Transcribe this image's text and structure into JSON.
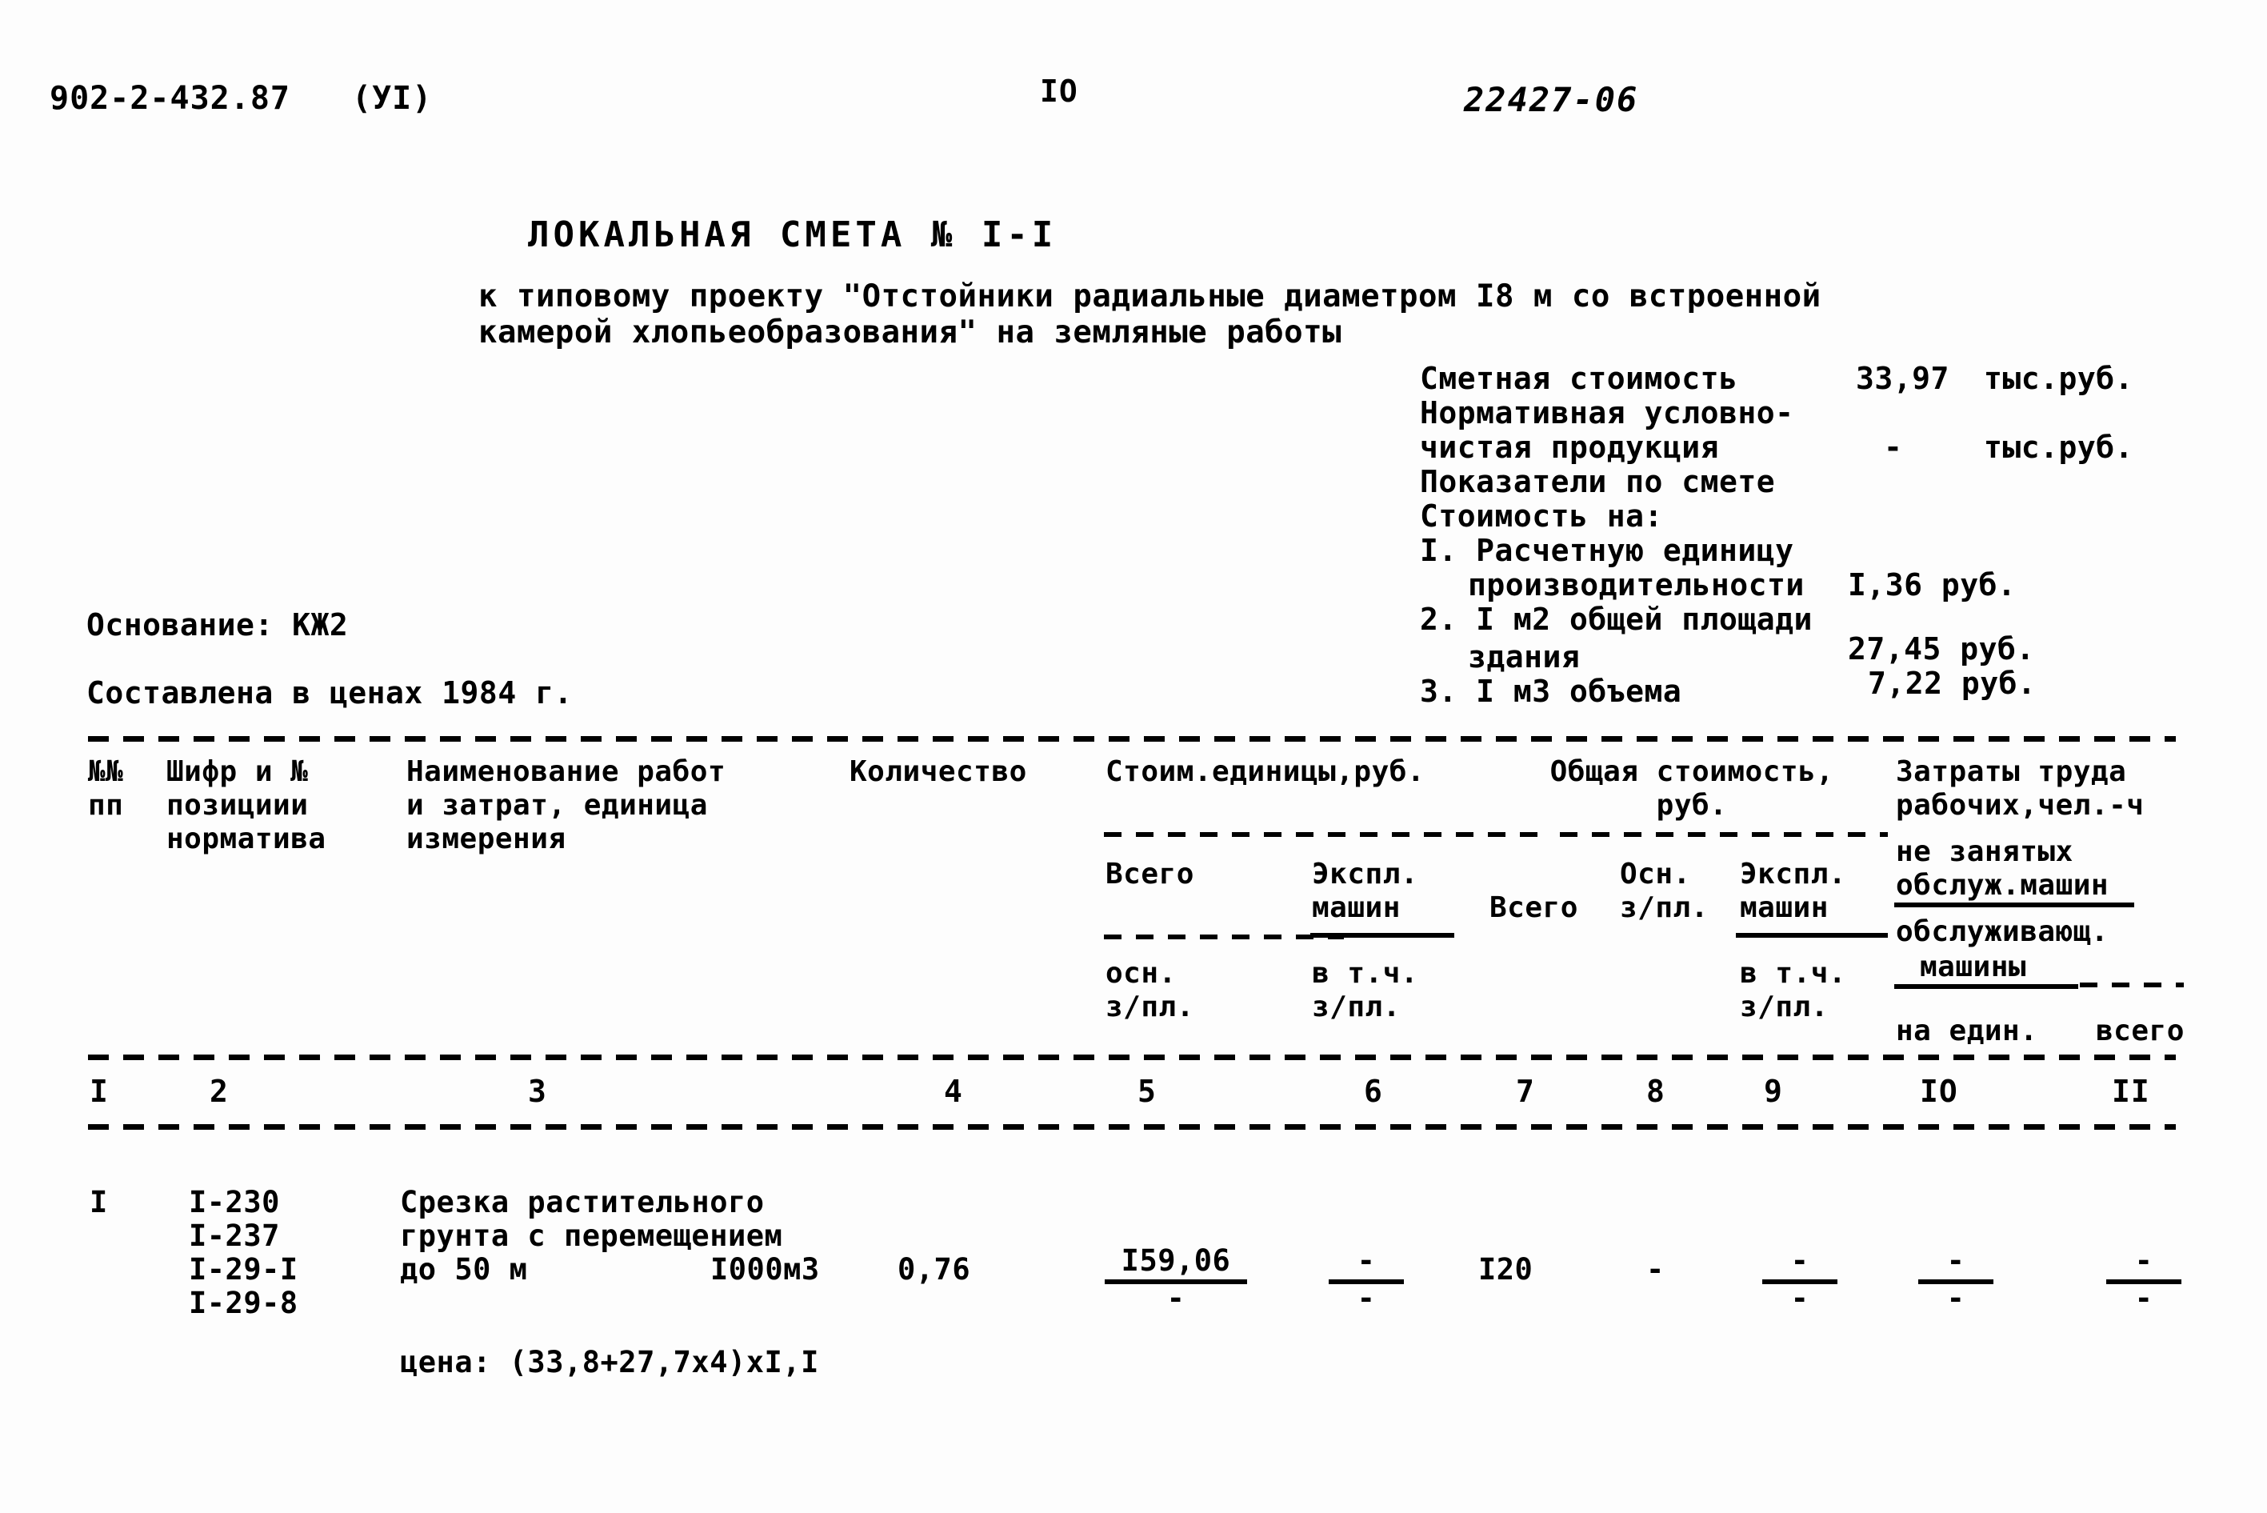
{
  "header": {
    "doc_code": "902-2-432.87",
    "section_roman": "(УI)",
    "page_number": "IO",
    "archive_stamp": "22427-06"
  },
  "title": {
    "main": "ЛОКАЛЬНАЯ СМЕТА № I-I",
    "subtitle_line1": "к типовому проекту \"Отстойники радиальные диаметром I8 м со встроенной",
    "subtitle_line2": "камерой хлопьеобразования\" на земляные работы"
  },
  "summary": {
    "rows": [
      {
        "label": "Сметная стоимость",
        "value": "33,97",
        "unit": "тыс.руб."
      },
      {
        "label": "Нормативная условно-",
        "value": "",
        "unit": ""
      },
      {
        "label": "чистая продукция",
        "value": "-",
        "unit": "тыс.руб."
      },
      {
        "label": "Показатели по смете",
        "value": "",
        "unit": ""
      },
      {
        "label": "Стоимость на:",
        "value": "",
        "unit": ""
      },
      {
        "label": "I. Расчетную единицу",
        "value": "",
        "unit": ""
      },
      {
        "label": "производительности",
        "value": "I,36 руб.",
        "unit": ""
      },
      {
        "label": "2. I м2 общей площади",
        "value": "",
        "unit": ""
      },
      {
        "label": "здания",
        "value": "27,45 руб.",
        "unit": ""
      },
      {
        "label": "3. I м3 объема",
        "value": "7,22 руб.",
        "unit": ""
      }
    ]
  },
  "meta": {
    "basis_label": "Основание: КЖ2",
    "prices_label": "Составлена в ценах 1984 г."
  },
  "table": {
    "headers": {
      "col1": "№№\nпп",
      "col2": "Шифр и №\nпозициии\nнорматива",
      "col3": "Наименование работ\nи затрат, единица\nизмерения",
      "col4": "Количество",
      "col5_group": "Стоим.единицы,руб.",
      "col8_group": "Общая стоимость,\nруб.",
      "col10_group": "Затраты труда\nрабочих,чел.-ч",
      "sub_vsego": "Всего",
      "sub_ekspl_mashin": "Экспл.\nмашин",
      "sub_osn_zpl": "осн.\nз/пл.",
      "sub_vtch_zpl": "в т.ч.\nз/пл.",
      "sub_vsego2": "Всего",
      "sub_osn_zpl2": "Осн.\nз/пл.",
      "sub_ekspl_mashin2": "Экспл.\nмашин",
      "sub_vtch_zpl2": "в т.ч.\nз/пл.",
      "sub_ne_zanyatyh": "не занятых",
      "sub_obsluzh_mashin": "обслуж.машин",
      "sub_obsluzhivayushch": "обслуживающ.",
      "sub_mashiny": "машины",
      "sub_na_edin": "на един.",
      "sub_vsego3": "всего"
    },
    "column_numbers": [
      "I",
      "2",
      "3",
      "4",
      "5",
      "6",
      "7",
      "8",
      "9",
      "IO",
      "II"
    ],
    "rows": [
      {
        "no": "I",
        "code_lines": [
          "I-230",
          "I-237",
          "I-29-I",
          "I-29-8"
        ],
        "name_lines": [
          "Срезка растительного",
          "грунта с перемещением",
          "до 50 м"
        ],
        "unit": "I000м3",
        "quantity": "0,76",
        "unit_cost_total_num": "I59,06",
        "unit_cost_total_den": "-",
        "unit_cost_mach_num": "-",
        "unit_cost_mach_den": "-",
        "total_vsego": "I20",
        "total_osn_zpl": "-",
        "total_mach_num": "-",
        "total_mach_den": "-",
        "labour_na_edin_num": "-",
        "labour_na_edin_den": "-",
        "labour_vsego_num": "-",
        "labour_vsego_den": "-"
      }
    ],
    "note": "цена: (33,8+27,7x4)xI,I"
  }
}
